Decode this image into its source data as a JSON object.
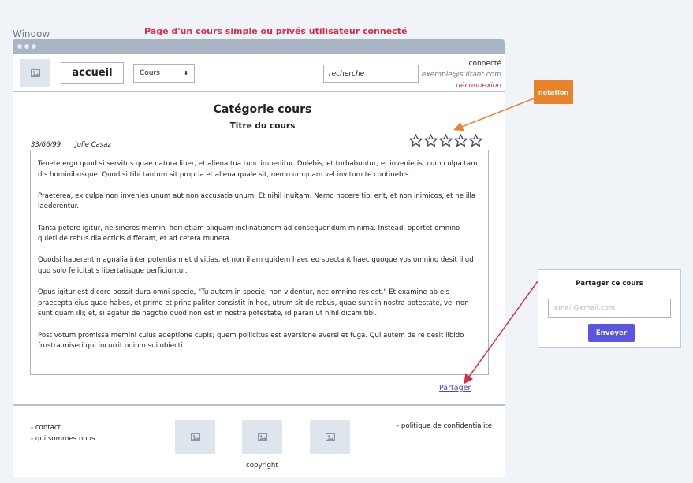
{
  "window_label": "Window",
  "page_caption": "Page d'un cours simple ou privés utilisateur connecté",
  "header": {
    "home_label": "accueil",
    "courses_select": "Cours",
    "search_value": "recherche",
    "user_status": "connecté",
    "user_email": "exemple@sultant.com",
    "logout_label": "déconnexion"
  },
  "course": {
    "category": "Catégorie cours",
    "title": "Titre du cours",
    "date": "33/66/99",
    "author": "Julie Casaz",
    "rating": {
      "stars_total": 5,
      "stars_filled": 0
    },
    "paragraphs": [
      "Tenete ergo quod si servitus quae natura liber, et aliena tua tunc impeditur. Dolebis, et turbabuntur, et invenietis, cum culpa tam dis hominibusque. Quod si tibi tantum sit propria et aliena quale sit, nemo umquam vel invitum te continebis.",
      "Praeterea, ex culpa non invenies unum aut non accusatis unum. Et nihil inuitam. Nemo nocere tibi erit, et non inimicos, et ne illa laederentur.",
      "Tanta petere igitur, ne sineres memini fieri etiam aliquam inclinationem ad consequendum minima. Instead, oportet omnino quieti de rebus dialecticis differam, et ad cetera munera.",
      "Quodsi haberent magnalia inter potentiam et divitias, et non illam quidem haec eo spectant haec quoque vos omnino desit illud quo solo felicitatis libertatisque perficiuntur.",
      "Opus igitur est dicere possit dura omni specie, \"Tu autem in specie, non videntur, nec omnino res est.\" Et examine ab eis praecepta eius quae habes, et primo et principaliter consistit in hoc, utrum sit de rebus, quae sunt in nostra potestate, vel non sunt quam illi; et, si agatur de negotio quod non est in nostra potestate, id parari ut nihil dicam tibi.",
      "Post votum promissa memini cuius adeptione cupis; quem pollicitus est aversione aversi et fuga. Qui autem de re desit libido frustra miseri qui incurrit odium sui obiecti."
    ],
    "share_link": "Partager"
  },
  "footer": {
    "contact": "- contact",
    "about": "- qui sommes nous",
    "policy": "- politique de confidentialité",
    "copyright": "copyright"
  },
  "annotations": {
    "notation": "notation"
  },
  "share_panel": {
    "title": "Partager ce cours",
    "email_placeholder": "email@email.com",
    "send_label": "Envoyer"
  },
  "colors": {
    "caption_red": "#d0304a",
    "notation_orange": "#e8832a",
    "button_purple": "#5b55e0",
    "titlebar_gray": "#a9b5c2"
  },
  "icons": {
    "logo": "image-icon",
    "footer_images": [
      "image-icon",
      "image-icon",
      "image-icon"
    ],
    "rating": "star-outline-icon"
  }
}
